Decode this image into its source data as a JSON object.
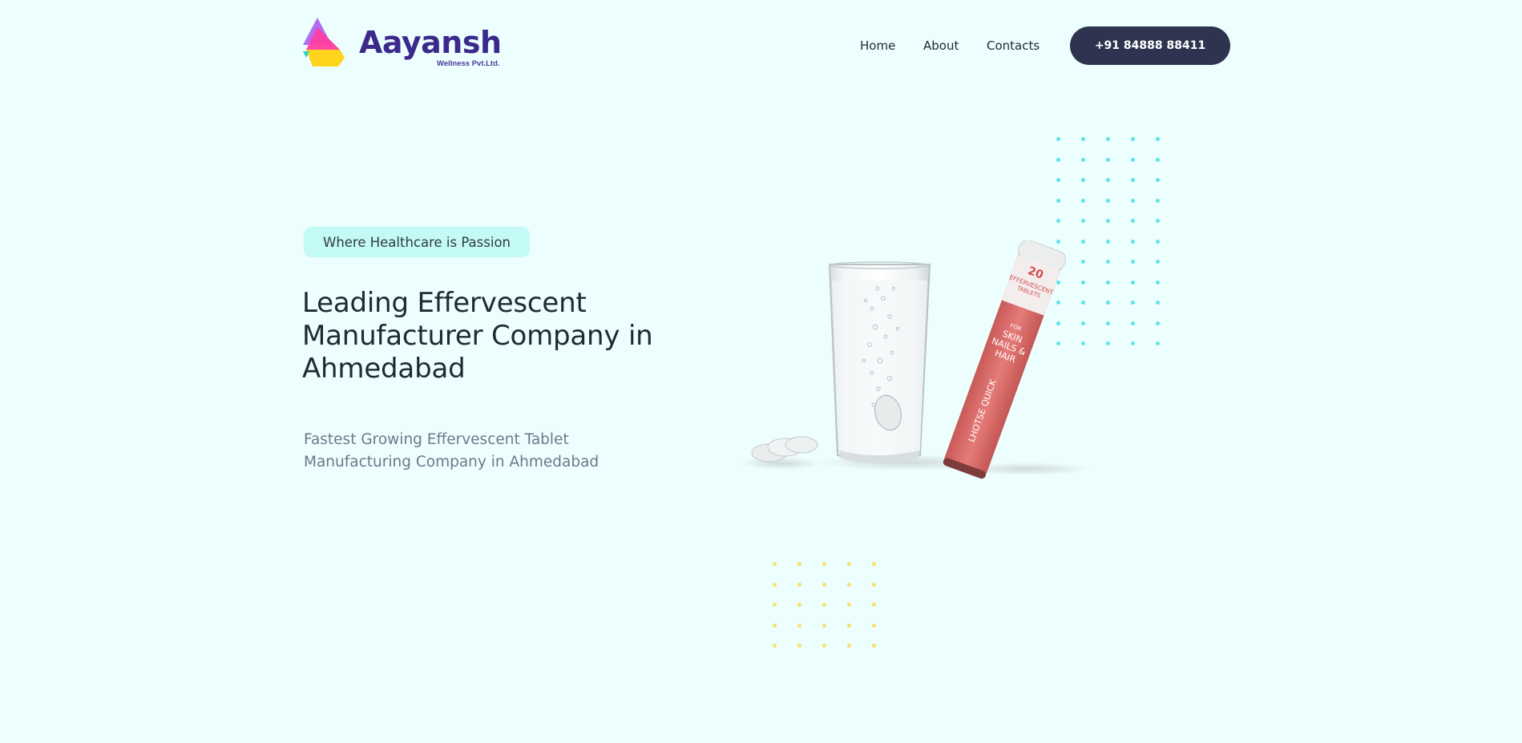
{
  "brand": {
    "name": "Aayansh",
    "subtitle": "Wellness Pvt.Ltd.",
    "colors": {
      "purple": "#b36cf0",
      "pink": "#ff3fa0",
      "yellow": "#ffd41c",
      "teal": "#2ed4c0",
      "text": "#3b2a8c"
    }
  },
  "nav": {
    "items": [
      {
        "label": "Home"
      },
      {
        "label": "About"
      },
      {
        "label": "Contacts"
      }
    ],
    "cta_label": "+91 84888 88411"
  },
  "hero": {
    "tagline": "Where Healthcare is Passion",
    "headline": "Leading Effervescent Manufacturer Company in Ahmedabad",
    "subheadline": "Fastest Growing Effervescent Tablet Manufacturing Company in Ahmedabad"
  },
  "product_image": {
    "tube_count": "20",
    "tube_line1": "EFFERVESCENT",
    "tube_line2": "TABLETS",
    "tube_for": "FOR",
    "tube_purpose_1": "SKIN",
    "tube_purpose_2": "NAILS &",
    "tube_purpose_3": "HAIR",
    "tube_brand": "LHOTSE QUICK",
    "tube_color": "#e0716f"
  },
  "theme": {
    "background": "#ecfefd",
    "cta_bg": "#2e3450",
    "tagline_bg": "#c4faf6",
    "dots_cyan": "#5ee3ea",
    "dots_yellow": "#f8e06a"
  }
}
